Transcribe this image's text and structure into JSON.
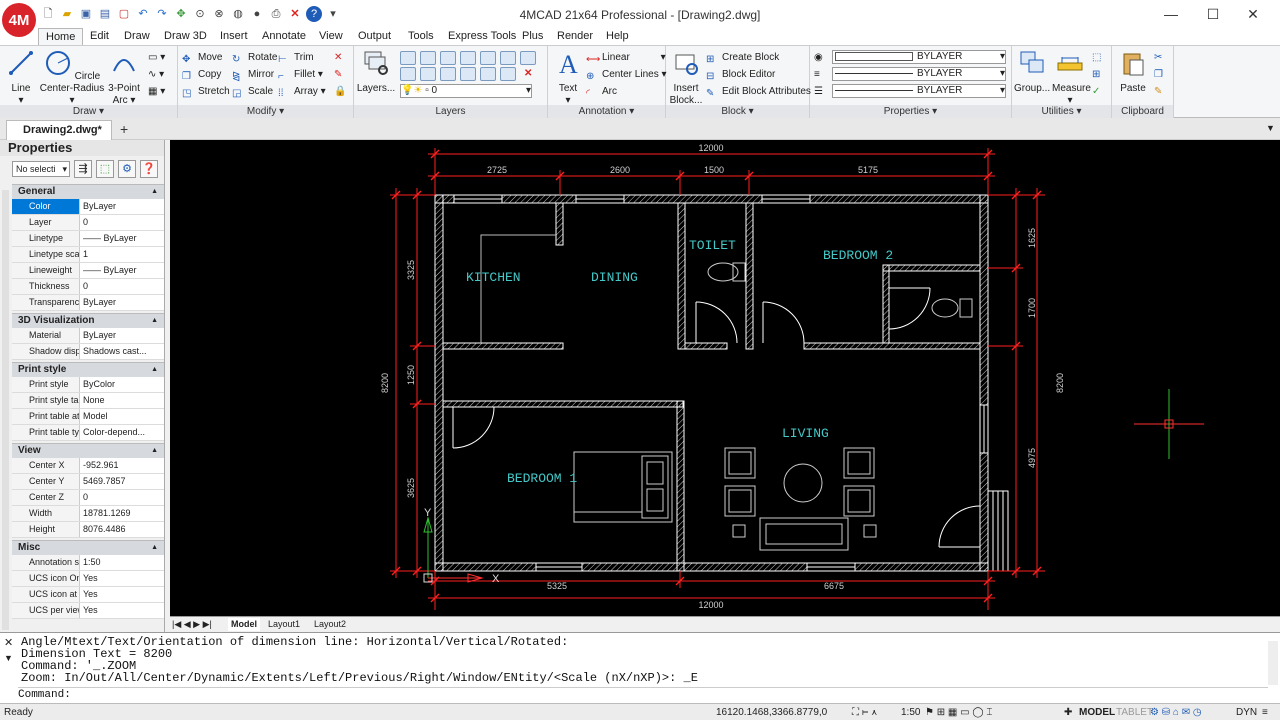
{
  "app": {
    "window_title": "4MCAD 21x64 Professional - [Drawing2.dwg]",
    "logo": "4M"
  },
  "quick_access": [
    "new-icon",
    "open-icon",
    "save-icon",
    "saveas-icon",
    "close-doc-icon",
    "undo-icon",
    "redo-icon",
    "pan-icon",
    "zoom-icon",
    "circle-icon",
    "sphere-icon",
    "shade-icon",
    "print-icon",
    "close-icon",
    "help-icon",
    "dropdown-icon"
  ],
  "window_controls": {
    "minimize": "—",
    "maximize": "☐",
    "close": "✕"
  },
  "menu": [
    "Home",
    "Edit",
    "Draw",
    "Draw 3D",
    "Insert",
    "Annotate",
    "View",
    "Output",
    "Tools",
    "Express Tools",
    "Plus",
    "Render",
    "Help"
  ],
  "ribbon": {
    "draw": {
      "label": "Draw",
      "line": "Line",
      "circle": "Circle",
      "circle_sub": "Center-Radius",
      "arc": "3-Point",
      "arc_sub": "Arc"
    },
    "modify": {
      "label": "Modify",
      "move": "Move",
      "rotate": "Rotate",
      "trim": "Trim",
      "copy": "Copy",
      "mirror": "Mirror",
      "fillet": "Fillet",
      "stretch": "Stretch",
      "scale": "Scale",
      "array": "Array"
    },
    "layers": {
      "label": "Layers",
      "layers_btn": "Layers...",
      "current_layer": "0"
    },
    "annotation": {
      "label": "Annotation",
      "text": "Text",
      "linear": "Linear",
      "center_lines": "Center Lines",
      "arc": "Arc"
    },
    "block": {
      "label": "Block",
      "insert": "Insert",
      "insert_sub": "Block...",
      "create": "Create Block",
      "editor": "Block Editor",
      "edit_attr": "Edit Block Attributes"
    },
    "properties": {
      "label": "Properties",
      "color": "BYLAYER",
      "linetype": "BYLAYER",
      "lineweight": "BYLAYER"
    },
    "utilities": {
      "label": "Utilities",
      "group": "Group...",
      "measure": "Measure"
    },
    "clipboard": {
      "label": "Clipboard",
      "paste": "Paste"
    }
  },
  "doc_tab": "Drawing2.dwg*",
  "new_tab": "+",
  "properties_panel": {
    "title": "Properties",
    "selection": "No selecti",
    "sections": [
      {
        "name": "General",
        "rows": [
          [
            "Color",
            "ByLayer"
          ],
          [
            "Layer",
            "0"
          ],
          [
            "Linetype",
            "—— ByLayer"
          ],
          [
            "Linetype scale",
            "1"
          ],
          [
            "Lineweight",
            "—— ByLayer"
          ],
          [
            "Thickness",
            "0"
          ],
          [
            "Transparency",
            "ByLayer"
          ]
        ]
      },
      {
        "name": "3D Visualization",
        "rows": [
          [
            "Material",
            "ByLayer"
          ],
          [
            "Shadow displ...",
            "Shadows cast..."
          ]
        ]
      },
      {
        "name": "Print style",
        "rows": [
          [
            "Print style",
            "ByColor"
          ],
          [
            "Print style table",
            "None"
          ],
          [
            "Print table att...",
            "Model"
          ],
          [
            "Print table type",
            "Color-depend..."
          ]
        ]
      },
      {
        "name": "View",
        "rows": [
          [
            "Center X",
            "-952.961"
          ],
          [
            "Center Y",
            "5469.7857"
          ],
          [
            "Center Z",
            "0"
          ],
          [
            "Width",
            "18781.1269"
          ],
          [
            "Height",
            "8076.4486"
          ]
        ]
      },
      {
        "name": "Misc",
        "rows": [
          [
            "Annotation sc...",
            "1:50"
          ],
          [
            "UCS icon On",
            "Yes"
          ],
          [
            "UCS icon at o...",
            "Yes"
          ],
          [
            "UCS per view",
            "Yes"
          ]
        ]
      }
    ]
  },
  "drawing": {
    "dims": {
      "top_total": "12000",
      "top_segments": [
        "2725",
        "2600",
        "1500",
        "5175"
      ],
      "bottom_total": "12000",
      "bottom_segments": [
        "5325",
        "6675"
      ],
      "left_total": "8200",
      "left_segments": [
        "3325",
        "1250",
        "3625"
      ],
      "right_total": "8200",
      "right_segments": [
        "1625",
        "1700",
        "4975"
      ]
    },
    "rooms": {
      "kitchen": "KITCHEN",
      "dining": "DINING",
      "toilet": "TOILET",
      "bedroom2": "BEDROOM 2",
      "living": "LIVING",
      "bedroom1": "BEDROOM 1"
    },
    "ucs": {
      "x": "X",
      "y": "Y"
    }
  },
  "layout_tabs": [
    "Model",
    "Layout1",
    "Layout2"
  ],
  "command_history": [
    "Angle/Mtext/Text/Orientation of dimension line:  Horizontal/Vertical/Rotated:",
    "Dimension Text = 8200",
    "Command: '_.ZOOM",
    "Zoom:  In/Out/All/Center/Dynamic/Extents/Left/Previous/Right/Window/ENtity/<Scale (nX/nXP)>: _E",
    "Command:"
  ],
  "status": {
    "ready": "Ready",
    "coords": "16120.1468,3366.8779,0",
    "scale": "1:50",
    "model": "MODEL",
    "tablet": "TABLET",
    "dyn": "DYN"
  },
  "colors": {
    "wall": "#ffffff",
    "dimension": "#ff2020",
    "room_text": "#45c8c8",
    "furniture": "#d0d0d0",
    "crosshair": "#30c030",
    "ribbon_accent": "#0078d7"
  }
}
